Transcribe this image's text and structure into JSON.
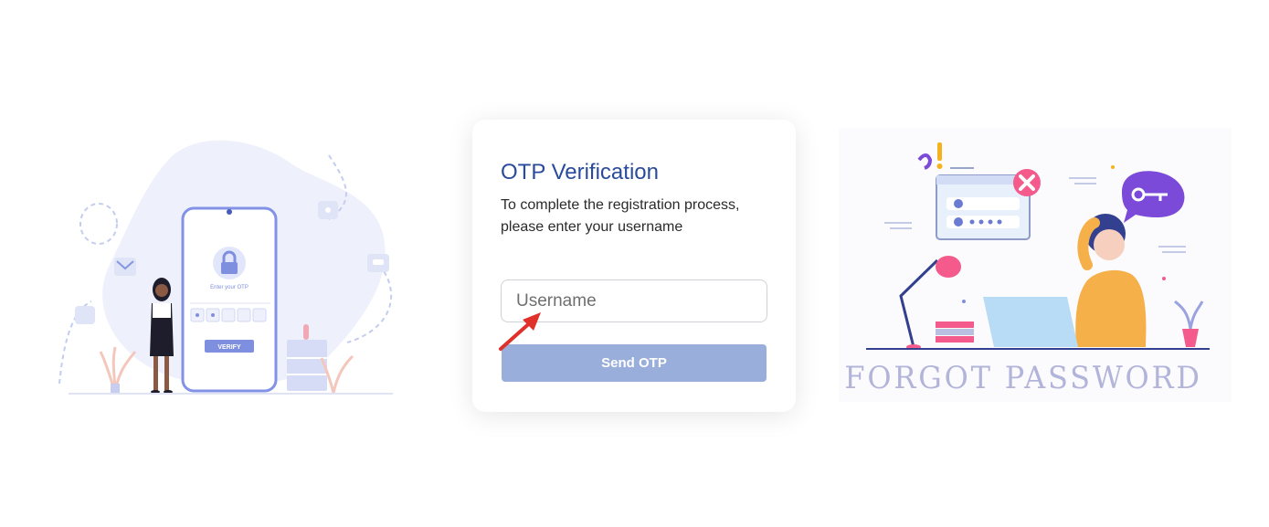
{
  "card": {
    "title": "OTP Verification",
    "description": "To complete the registration process, please enter your username"
  },
  "form": {
    "username_placeholder": "Username",
    "username_value": "",
    "send_label": "Send OTP"
  },
  "left_illustration": {
    "screen_label": "Enter your OTP",
    "verify_label": "VERIFY"
  },
  "right_illustration": {
    "caption": "FORGOT PASSWORD"
  },
  "colors": {
    "title": "#2a4a9b",
    "button": "#9aaedb",
    "accent_purple": "#7f8fe0",
    "annotation_arrow": "#e0302a"
  },
  "icons": [
    "lock-icon",
    "mail-icon",
    "chat-icon",
    "key-icon",
    "close-icon",
    "arrow-pointer-icon"
  ]
}
